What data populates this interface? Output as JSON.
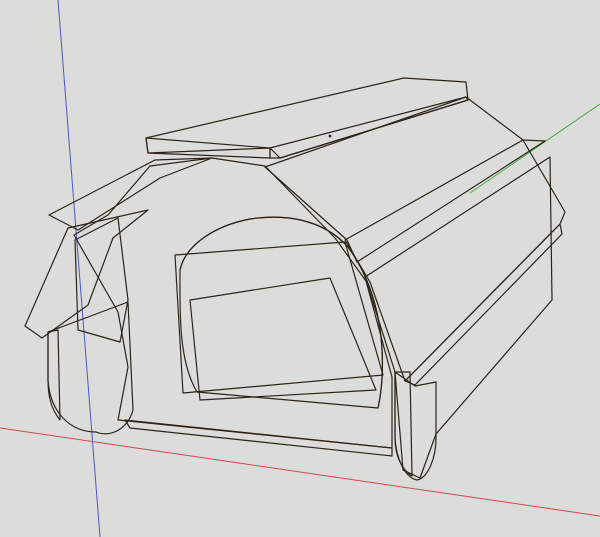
{
  "viewport": {
    "background": "#dcdcda",
    "axes": {
      "red": "#d04a4a",
      "green": "#3fae3f",
      "blue": "#4c57c9"
    }
  },
  "model": {
    "materials": {
      "wood_light": "#c9a664",
      "wood_mid": "#b38d4f",
      "wood_dark": "#8b6a35",
      "wood_shadow": "#6d5127",
      "edge": "#2b2418"
    }
  }
}
